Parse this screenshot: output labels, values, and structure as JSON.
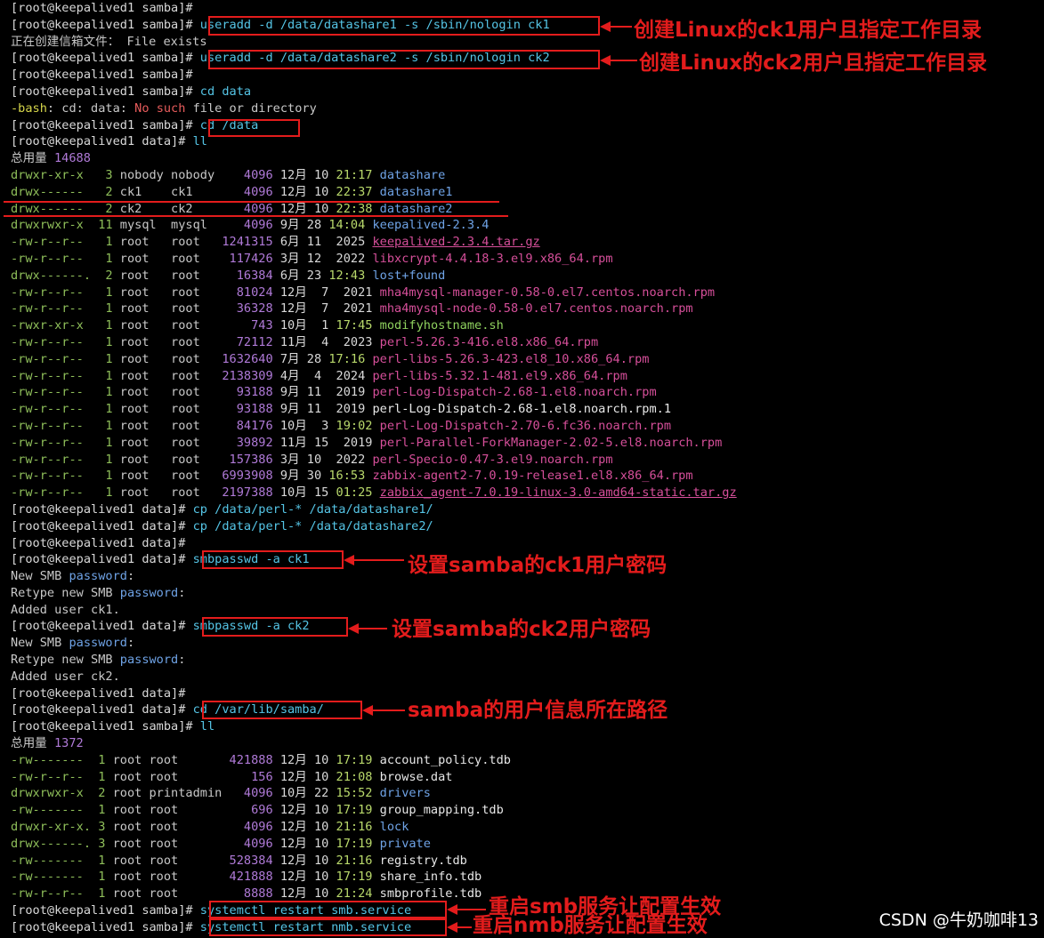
{
  "lines": [
    [
      {
        "t": "[root@keepalived1 samba]# ",
        "c": "prompt"
      }
    ],
    [
      {
        "t": "[root@keepalived1 samba]# ",
        "c": "prompt"
      },
      {
        "t": "useradd -d /data/datashare1 -s /sbin/nologin ck1",
        "c": "cmd"
      }
    ],
    [
      {
        "t": "正在创建信箱文件： File exists",
        "c": "gray"
      }
    ],
    [
      {
        "t": "[root@keepalived1 samba]# ",
        "c": "prompt"
      },
      {
        "t": "useradd -d /data/datashare2 -s /sbin/nologin ck2",
        "c": "cmd"
      }
    ],
    [
      {
        "t": "[root@keepalived1 samba]# ",
        "c": "prompt"
      }
    ],
    [
      {
        "t": "[root@keepalived1 samba]# ",
        "c": "prompt"
      },
      {
        "t": "cd data",
        "c": "cmd"
      }
    ],
    [
      {
        "t": "-bash",
        "c": "perm-y"
      },
      {
        "t": ": cd: data: ",
        "c": "gray"
      },
      {
        "t": "No such",
        "c": "err"
      },
      {
        "t": " file or directory",
        "c": "gray"
      }
    ],
    [
      {
        "t": "[root@keepalived1 samba]# ",
        "c": "prompt"
      },
      {
        "t": "cd /data",
        "c": "cmd"
      }
    ],
    [
      {
        "t": "[root@keepalived1 data]# ",
        "c": "prompt"
      },
      {
        "t": "ll",
        "c": "cmd"
      }
    ],
    [
      {
        "t": "总用量 ",
        "c": "gray"
      },
      {
        "t": "14688",
        "c": "num-p"
      }
    ],
    [
      {
        "t": "drwxr-xr-x   3 ",
        "c": "perm-g"
      },
      {
        "t": "nobody nobody    ",
        "c": "gray"
      },
      {
        "t": "4096 ",
        "c": "num-p"
      },
      {
        "t": "12月 10 ",
        "c": "date-m"
      },
      {
        "t": "21:17 ",
        "c": "time-g"
      },
      {
        "t": "datashare",
        "c": "dir-b"
      }
    ],
    [
      {
        "t": "drwx------   2 ",
        "c": "perm-g"
      },
      {
        "t": "ck1    ck1       ",
        "c": "gray"
      },
      {
        "t": "4096 ",
        "c": "num-p"
      },
      {
        "t": "12月 10 ",
        "c": "date-m"
      },
      {
        "t": "22:37 ",
        "c": "time-g"
      },
      {
        "t": "datashare1",
        "c": "dir-b"
      }
    ],
    [
      {
        "t": "drwx------   2 ",
        "c": "perm-g"
      },
      {
        "t": "ck2    ck2       ",
        "c": "gray"
      },
      {
        "t": "4096 ",
        "c": "num-p"
      },
      {
        "t": "12月 10 ",
        "c": "date-m"
      },
      {
        "t": "22:38 ",
        "c": "time-g"
      },
      {
        "t": "datashare2",
        "c": "dir-b"
      }
    ],
    [
      {
        "t": "drwxrwxr-x  11 ",
        "c": "perm-g"
      },
      {
        "t": "mysql  mysql     ",
        "c": "gray"
      },
      {
        "t": "4096 ",
        "c": "num-p"
      },
      {
        "t": "9月 28 ",
        "c": "date-m"
      },
      {
        "t": "14:04 ",
        "c": "time-g"
      },
      {
        "t": "keepalived-2.3.4",
        "c": "dir-b"
      }
    ],
    [
      {
        "t": "-rw-r--r--   1 ",
        "c": "perm-g"
      },
      {
        "t": "root   root   ",
        "c": "gray"
      },
      {
        "t": "1241315 ",
        "c": "num-p"
      },
      {
        "t": "6月 11  2025 ",
        "c": "date-m"
      },
      {
        "t": "keepalived-2.3.4.tar.gz",
        "c": "file-m ul"
      }
    ],
    [
      {
        "t": "-rw-r--r--   1 ",
        "c": "perm-g"
      },
      {
        "t": "root   root    ",
        "c": "gray"
      },
      {
        "t": "117426 ",
        "c": "num-p"
      },
      {
        "t": "3月 12  2022 ",
        "c": "date-m"
      },
      {
        "t": "libxcrypt-4.4.18-3.el9.x86_64.rpm",
        "c": "file-m"
      }
    ],
    [
      {
        "t": "drwx------.  2 ",
        "c": "perm-g"
      },
      {
        "t": "root   root     ",
        "c": "gray"
      },
      {
        "t": "16384 ",
        "c": "num-p"
      },
      {
        "t": "6月 23 ",
        "c": "date-m"
      },
      {
        "t": "12:43 ",
        "c": "time-g"
      },
      {
        "t": "lost+found",
        "c": "dir-b"
      }
    ],
    [
      {
        "t": "-rw-r--r--   1 ",
        "c": "perm-g"
      },
      {
        "t": "root   root     ",
        "c": "gray"
      },
      {
        "t": "81024 ",
        "c": "num-p"
      },
      {
        "t": "12月  7  2021 ",
        "c": "date-m"
      },
      {
        "t": "mha4mysql-manager-0.58-0.el7.centos.noarch.rpm",
        "c": "file-m"
      }
    ],
    [
      {
        "t": "-rw-r--r--   1 ",
        "c": "perm-g"
      },
      {
        "t": "root   root     ",
        "c": "gray"
      },
      {
        "t": "36328 ",
        "c": "num-p"
      },
      {
        "t": "12月  7  2021 ",
        "c": "date-m"
      },
      {
        "t": "mha4mysql-node-0.58-0.el7.centos.noarch.rpm",
        "c": "file-m"
      }
    ],
    [
      {
        "t": "-rwxr-xr-x   1 ",
        "c": "perm-g"
      },
      {
        "t": "root   root       ",
        "c": "gray"
      },
      {
        "t": "743 ",
        "c": "num-p"
      },
      {
        "t": "10月  1 ",
        "c": "date-m"
      },
      {
        "t": "17:45 ",
        "c": "time-g"
      },
      {
        "t": "modifyhostname.sh",
        "c": "file-g"
      }
    ],
    [
      {
        "t": "-rw-r--r--   1 ",
        "c": "perm-g"
      },
      {
        "t": "root   root     ",
        "c": "gray"
      },
      {
        "t": "72112 ",
        "c": "num-p"
      },
      {
        "t": "11月  4  2023 ",
        "c": "date-m"
      },
      {
        "t": "perl-5.26.3-416.el8.x86_64.rpm",
        "c": "file-m"
      }
    ],
    [
      {
        "t": "-rw-r--r--   1 ",
        "c": "perm-g"
      },
      {
        "t": "root   root   ",
        "c": "gray"
      },
      {
        "t": "1632640 ",
        "c": "num-p"
      },
      {
        "t": "7月 28 ",
        "c": "date-m"
      },
      {
        "t": "17:16 ",
        "c": "time-g"
      },
      {
        "t": "perl-libs-5.26.3-423.el8_10.x86_64.rpm",
        "c": "file-m"
      }
    ],
    [
      {
        "t": "-rw-r--r--   1 ",
        "c": "perm-g"
      },
      {
        "t": "root   root   ",
        "c": "gray"
      },
      {
        "t": "2138309 ",
        "c": "num-p"
      },
      {
        "t": "4月  4  2024 ",
        "c": "date-m"
      },
      {
        "t": "perl-libs-5.32.1-481.el9.x86_64.rpm",
        "c": "file-m"
      }
    ],
    [
      {
        "t": "-rw-r--r--   1 ",
        "c": "perm-g"
      },
      {
        "t": "root   root     ",
        "c": "gray"
      },
      {
        "t": "93188 ",
        "c": "num-p"
      },
      {
        "t": "9月 11  2019 ",
        "c": "date-m"
      },
      {
        "t": "perl-Log-Dispatch-2.68-1.el8.noarch.rpm",
        "c": "file-m"
      }
    ],
    [
      {
        "t": "-rw-r--r--   1 ",
        "c": "perm-g"
      },
      {
        "t": "root   root     ",
        "c": "gray"
      },
      {
        "t": "93188 ",
        "c": "num-p"
      },
      {
        "t": "9月 11  2019 ",
        "c": "date-m"
      },
      {
        "t": "perl-Log-Dispatch-2.68-1.el8.noarch.rpm.1",
        "c": "file-w"
      }
    ],
    [
      {
        "t": "-rw-r--r--   1 ",
        "c": "perm-g"
      },
      {
        "t": "root   root     ",
        "c": "gray"
      },
      {
        "t": "84176 ",
        "c": "num-p"
      },
      {
        "t": "10月  3 ",
        "c": "date-m"
      },
      {
        "t": "19:02 ",
        "c": "time-g"
      },
      {
        "t": "perl-Log-Dispatch-2.70-6.fc36.noarch.rpm",
        "c": "file-m"
      }
    ],
    [
      {
        "t": "-rw-r--r--   1 ",
        "c": "perm-g"
      },
      {
        "t": "root   root     ",
        "c": "gray"
      },
      {
        "t": "39892 ",
        "c": "num-p"
      },
      {
        "t": "11月 15  2019 ",
        "c": "date-m"
      },
      {
        "t": "perl-Parallel-ForkManager-2.02-5.el8.noarch.rpm",
        "c": "file-m"
      }
    ],
    [
      {
        "t": "-rw-r--r--   1 ",
        "c": "perm-g"
      },
      {
        "t": "root   root    ",
        "c": "gray"
      },
      {
        "t": "157386 ",
        "c": "num-p"
      },
      {
        "t": "3月 10  2022 ",
        "c": "date-m"
      },
      {
        "t": "perl-Specio-0.47-3.el9.noarch.rpm",
        "c": "file-m"
      }
    ],
    [
      {
        "t": "-rw-r--r--   1 ",
        "c": "perm-g"
      },
      {
        "t": "root   root   ",
        "c": "gray"
      },
      {
        "t": "6993908 ",
        "c": "num-p"
      },
      {
        "t": "9月 30 ",
        "c": "date-m"
      },
      {
        "t": "16:53 ",
        "c": "time-g"
      },
      {
        "t": "zabbix-agent2-7.0.19-release1.el8.x86_64.rpm",
        "c": "file-m"
      }
    ],
    [
      {
        "t": "-rw-r--r--   1 ",
        "c": "perm-g"
      },
      {
        "t": "root   root   ",
        "c": "gray"
      },
      {
        "t": "2197388 ",
        "c": "num-p"
      },
      {
        "t": "10月 15 ",
        "c": "date-m"
      },
      {
        "t": "01:25 ",
        "c": "time-g"
      },
      {
        "t": "zabbix_agent-7.0.19-linux-3.0-amd64-static.tar.gz",
        "c": "file-m ul"
      }
    ],
    [
      {
        "t": "[root@keepalived1 data]# ",
        "c": "prompt"
      },
      {
        "t": "cp /data/perl-* /data/datashare1/",
        "c": "cmd"
      }
    ],
    [
      {
        "t": "[root@keepalived1 data]# ",
        "c": "prompt"
      },
      {
        "t": "cp /data/perl-* /data/datashare2/",
        "c": "cmd"
      }
    ],
    [
      {
        "t": "[root@keepalived1 data]# ",
        "c": "prompt"
      }
    ],
    [
      {
        "t": "[root@keepalived1 data]# ",
        "c": "prompt"
      },
      {
        "t": "smbpasswd -a ck1",
        "c": "cmd"
      }
    ],
    [
      {
        "t": "New SMB ",
        "c": "gray"
      },
      {
        "t": "password",
        "c": "dir-b"
      },
      {
        "t": ":",
        "c": "gray"
      }
    ],
    [
      {
        "t": "Retype new SMB ",
        "c": "gray"
      },
      {
        "t": "password",
        "c": "dir-b"
      },
      {
        "t": ":",
        "c": "gray"
      }
    ],
    [
      {
        "t": "Added user ck1.",
        "c": "gray"
      }
    ],
    [
      {
        "t": "[root@keepalived1 data]# ",
        "c": "prompt"
      },
      {
        "t": "smbpasswd -a ck2",
        "c": "cmd"
      }
    ],
    [
      {
        "t": "New SMB ",
        "c": "gray"
      },
      {
        "t": "password",
        "c": "dir-b"
      },
      {
        "t": ":",
        "c": "gray"
      }
    ],
    [
      {
        "t": "Retype new SMB ",
        "c": "gray"
      },
      {
        "t": "password",
        "c": "dir-b"
      },
      {
        "t": ":",
        "c": "gray"
      }
    ],
    [
      {
        "t": "Added user ck2.",
        "c": "gray"
      }
    ],
    [
      {
        "t": "[root@keepalived1 data]# ",
        "c": "prompt"
      }
    ],
    [
      {
        "t": "[root@keepalived1 data]# ",
        "c": "prompt"
      },
      {
        "t": "cd /var/lib/samba/",
        "c": "cmd"
      }
    ],
    [
      {
        "t": "[root@keepalived1 samba]# ",
        "c": "prompt"
      },
      {
        "t": "ll",
        "c": "cmd"
      }
    ],
    [
      {
        "t": "总用量 ",
        "c": "gray"
      },
      {
        "t": "1372",
        "c": "num-p"
      }
    ],
    [
      {
        "t": "-rw-------  1 ",
        "c": "perm-g"
      },
      {
        "t": "root root       ",
        "c": "gray"
      },
      {
        "t": "421888 ",
        "c": "num-p"
      },
      {
        "t": "12月 10 ",
        "c": "date-m"
      },
      {
        "t": "17:19 ",
        "c": "time-g"
      },
      {
        "t": "account_policy.tdb",
        "c": "file-w"
      }
    ],
    [
      {
        "t": "-rw-r--r--  1 ",
        "c": "perm-g"
      },
      {
        "t": "root root          ",
        "c": "gray"
      },
      {
        "t": "156 ",
        "c": "num-p"
      },
      {
        "t": "12月 10 ",
        "c": "date-m"
      },
      {
        "t": "21:08 ",
        "c": "time-g"
      },
      {
        "t": "browse.dat",
        "c": "file-w"
      }
    ],
    [
      {
        "t": "drwxrwxr-x  2 ",
        "c": "perm-g"
      },
      {
        "t": "root printadmin   ",
        "c": "gray"
      },
      {
        "t": "4096 ",
        "c": "num-p"
      },
      {
        "t": "10月 22 ",
        "c": "date-m"
      },
      {
        "t": "15:52 ",
        "c": "time-g"
      },
      {
        "t": "drivers",
        "c": "dir-b"
      }
    ],
    [
      {
        "t": "-rw-------  1 ",
        "c": "perm-g"
      },
      {
        "t": "root root          ",
        "c": "gray"
      },
      {
        "t": "696 ",
        "c": "num-p"
      },
      {
        "t": "12月 10 ",
        "c": "date-m"
      },
      {
        "t": "17:19 ",
        "c": "time-g"
      },
      {
        "t": "group_mapping.tdb",
        "c": "file-w"
      }
    ],
    [
      {
        "t": "drwxr-xr-x. 3 ",
        "c": "perm-g"
      },
      {
        "t": "root root         ",
        "c": "gray"
      },
      {
        "t": "4096 ",
        "c": "num-p"
      },
      {
        "t": "12月 10 ",
        "c": "date-m"
      },
      {
        "t": "21:16 ",
        "c": "time-g"
      },
      {
        "t": "lock",
        "c": "dir-b"
      }
    ],
    [
      {
        "t": "drwx------. 3 ",
        "c": "perm-g"
      },
      {
        "t": "root root         ",
        "c": "gray"
      },
      {
        "t": "4096 ",
        "c": "num-p"
      },
      {
        "t": "12月 10 ",
        "c": "date-m"
      },
      {
        "t": "17:19 ",
        "c": "time-g"
      },
      {
        "t": "private",
        "c": "dir-b"
      }
    ],
    [
      {
        "t": "-rw-------  1 ",
        "c": "perm-g"
      },
      {
        "t": "root root       ",
        "c": "gray"
      },
      {
        "t": "528384 ",
        "c": "num-p"
      },
      {
        "t": "12月 10 ",
        "c": "date-m"
      },
      {
        "t": "21:16 ",
        "c": "time-g"
      },
      {
        "t": "registry.tdb",
        "c": "file-w"
      }
    ],
    [
      {
        "t": "-rw-------  1 ",
        "c": "perm-g"
      },
      {
        "t": "root root       ",
        "c": "gray"
      },
      {
        "t": "421888 ",
        "c": "num-p"
      },
      {
        "t": "12月 10 ",
        "c": "date-m"
      },
      {
        "t": "17:19 ",
        "c": "time-g"
      },
      {
        "t": "share_info.tdb",
        "c": "file-w"
      }
    ],
    [
      {
        "t": "-rw-r--r--  1 ",
        "c": "perm-g"
      },
      {
        "t": "root root         ",
        "c": "gray"
      },
      {
        "t": "8888 ",
        "c": "num-p"
      },
      {
        "t": "12月 10 ",
        "c": "date-m"
      },
      {
        "t": "21:24 ",
        "c": "time-g"
      },
      {
        "t": "smbprofile.tdb",
        "c": "file-w"
      }
    ],
    [
      {
        "t": "[root@keepalived1 samba]# ",
        "c": "prompt"
      },
      {
        "t": "systemctl restart smb.service",
        "c": "cmd"
      }
    ],
    [
      {
        "t": "[root@keepalived1 samba]# ",
        "c": "prompt"
      },
      {
        "t": "systemctl restart nmb.service",
        "c": "cmd"
      }
    ]
  ],
  "annotations": {
    "note1": "创建Linux的ck1用户且指定工作目录",
    "note2": "创建Linux的ck2用户且指定工作目录",
    "note3": "设置samba的ck1用户密码",
    "note4": "设置samba的ck2用户密码",
    "note5": "samba的用户信息所在路径",
    "note6": "重启smb服务让配置生效",
    "note7": "重启nmb服务让配置生效"
  },
  "watermark": "CSDN @牛奶咖啡13",
  "colors": {
    "annotation": "#e31c1c",
    "background": "#000000",
    "command": "#55c5e6"
  }
}
